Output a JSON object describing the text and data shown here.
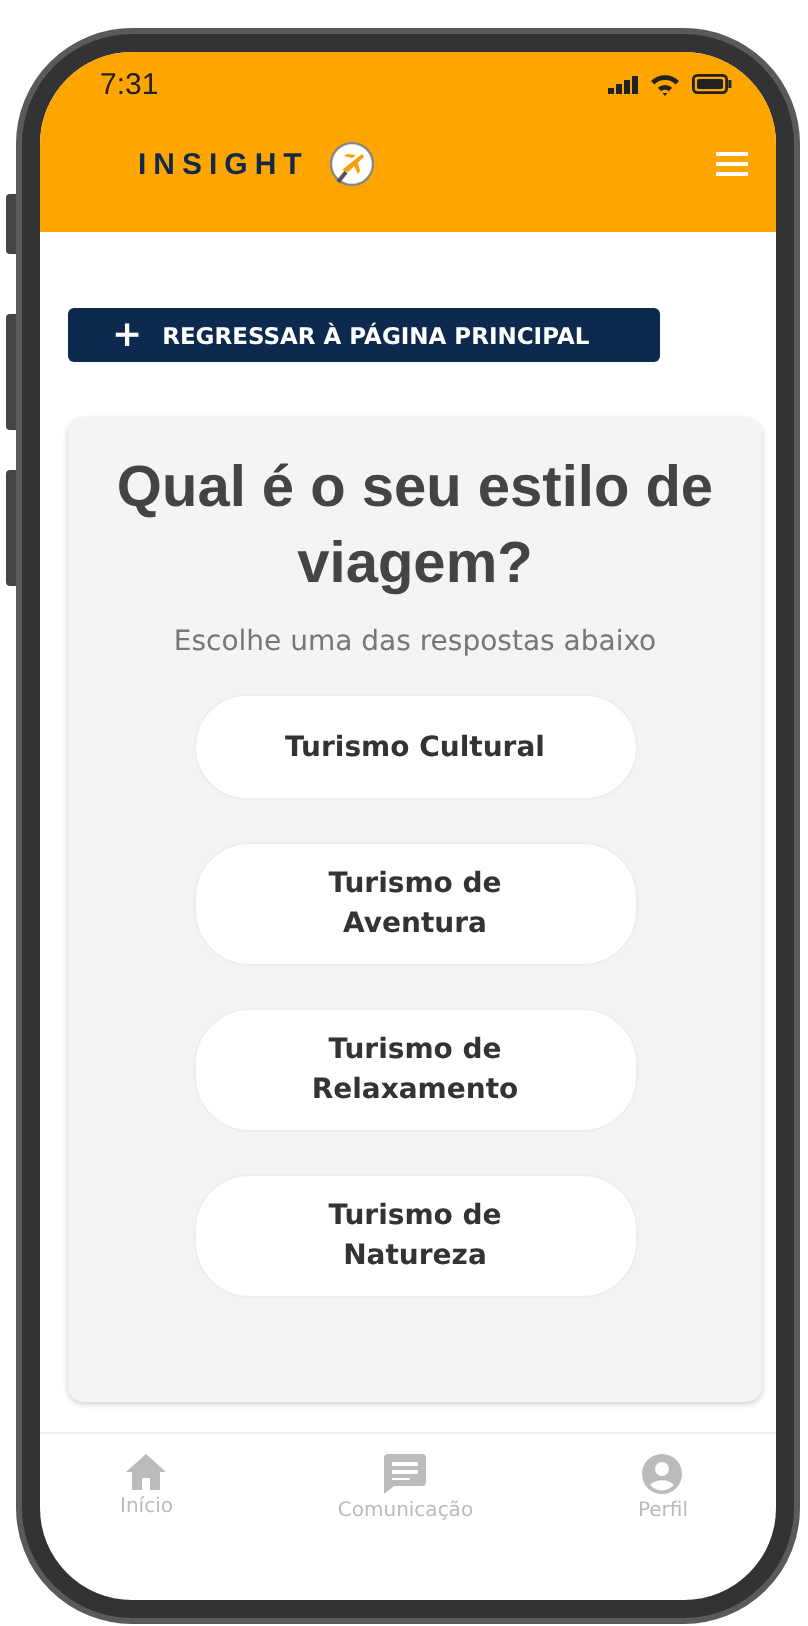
{
  "status_bar": {
    "time": "7:31"
  },
  "header": {
    "logo_text": "INSIGHT"
  },
  "back_button": {
    "icon": "+",
    "label": "REGRESSAR À PÁGINA PRINCIPAL"
  },
  "question": {
    "title": "Qual é o seu estilo de viagem?",
    "subtitle": "Escolhe uma das respostas abaixo"
  },
  "answers": [
    {
      "label": "Turismo Cultural"
    },
    {
      "label": "Turismo de Aventura"
    },
    {
      "label": "Turismo de Relaxamento"
    },
    {
      "label": "Turismo de Natureza"
    }
  ],
  "bottom_nav": [
    {
      "kind": "home",
      "label": "Início"
    },
    {
      "kind": "chat",
      "label": "Comunicação"
    },
    {
      "kind": "profile",
      "label": "Perfil"
    }
  ]
}
